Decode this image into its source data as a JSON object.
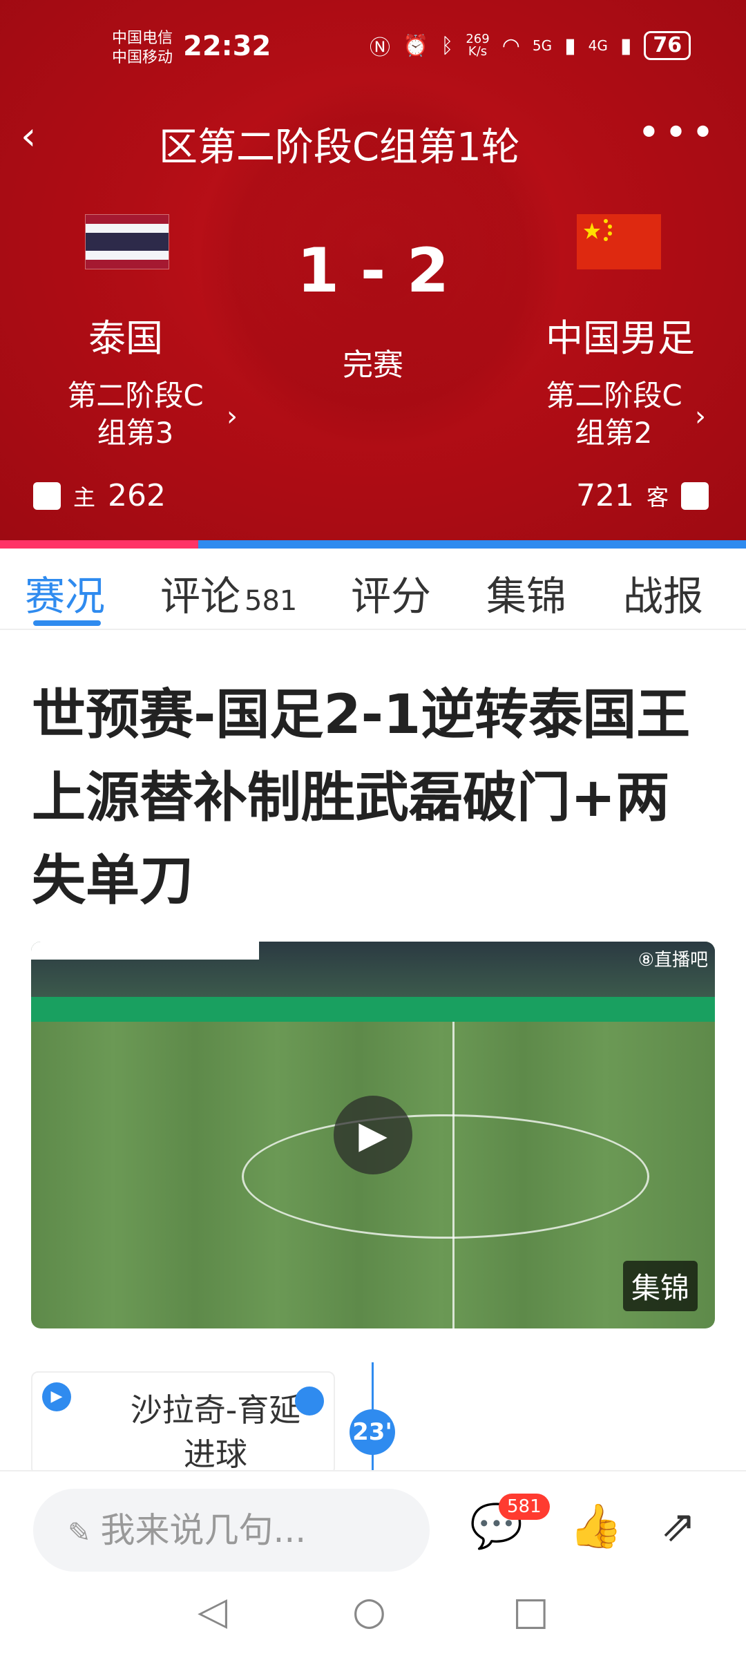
{
  "status_bar": {
    "carrier1": "中国电信",
    "carrier2": "中国移动",
    "time": "22:32",
    "net_speed_value": "269",
    "net_speed_unit": "K/s",
    "signal1": "5G",
    "signal2": "4G",
    "battery": "76"
  },
  "header": {
    "title": "区第二阶段C组第1轮",
    "back_glyph": "‹",
    "more_glyph": "•••"
  },
  "match": {
    "score": "1 - 2",
    "status": "完赛",
    "home": {
      "name": "泰国",
      "rank_line1": "第二阶段C",
      "rank_line2": "组第3",
      "like_tag": "主",
      "likes": "262",
      "flag_colors": [
        "#a51931",
        "#f4f5f8",
        "#2d2a4a",
        "#f4f5f8",
        "#a51931"
      ]
    },
    "away": {
      "name": "中国男足",
      "rank_line1": "第二阶段C",
      "rank_line2": "组第2",
      "like_tag": "客",
      "likes": "721"
    },
    "chevron": "›",
    "home_support_fraction": 0.266
  },
  "tabs": [
    {
      "label": "赛况",
      "count": ""
    },
    {
      "label": "评论",
      "count": "581"
    },
    {
      "label": "评分",
      "count": ""
    },
    {
      "label": "集锦",
      "count": ""
    },
    {
      "label": "战报",
      "count": ""
    }
  ],
  "article": {
    "headline": "世预赛-国足2-1逆转泰国王上源替补制胜武磊破门+两失单刀"
  },
  "video": {
    "tag": "集锦",
    "brand_overlay": "⑧直播吧",
    "play_glyph": "▶"
  },
  "event": {
    "text": "沙拉奇-育延进球",
    "minute": "23'",
    "play_glyph": "▶"
  },
  "bottom_bar": {
    "comment_placeholder": "我来说几句...",
    "pen_glyph": "✎",
    "comment_count": "581",
    "comment_icon": "💬",
    "like_icon": "👍",
    "share_icon": "⇗"
  },
  "nav": {
    "back": "◁",
    "home": "○",
    "recent": "□"
  },
  "colors": {
    "header_red": "#b10d15",
    "accent_blue": "#2f8bef",
    "home_bar": "#ff3366",
    "badge_red": "#ff3b30"
  }
}
